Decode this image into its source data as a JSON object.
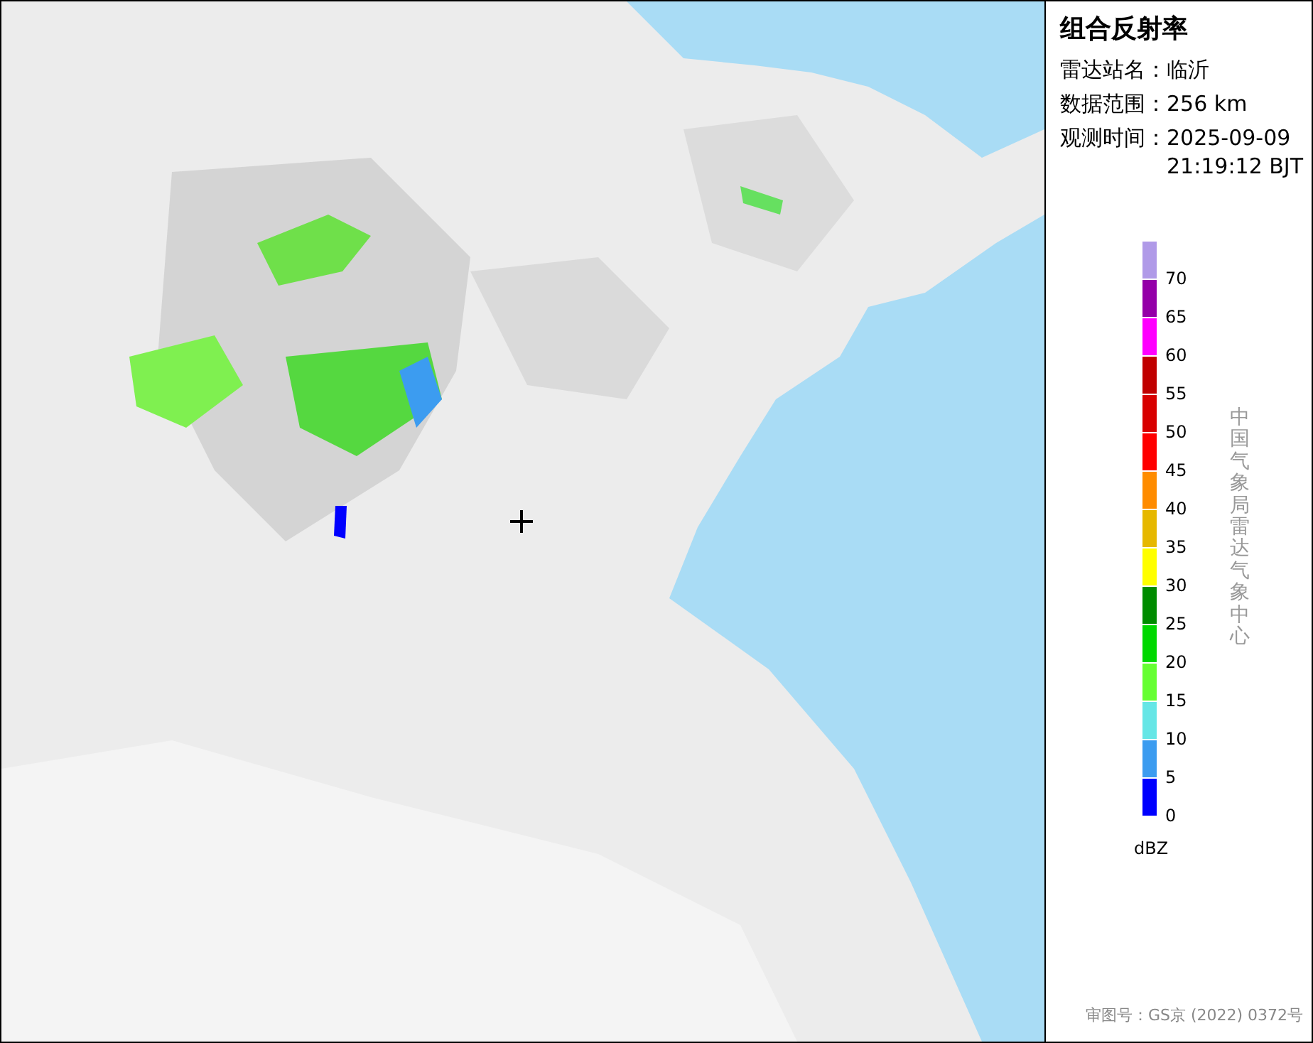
{
  "panel": {
    "title": "组合反射率",
    "info": [
      {
        "label": "雷达站名：",
        "lines": [
          "临沂"
        ]
      },
      {
        "label": "数据范围：",
        "lines": [
          "256 km"
        ]
      },
      {
        "label": "观测时间：",
        "lines": [
          "2025-09-09",
          "21:19:12 BJT"
        ]
      }
    ],
    "legend": [
      {
        "label": "70",
        "color": "#b09ae8"
      },
      {
        "label": "65",
        "color": "#9400a8"
      },
      {
        "label": "60",
        "color": "#ff00ff"
      },
      {
        "label": "55",
        "color": "#c00000"
      },
      {
        "label": "50",
        "color": "#d80000"
      },
      {
        "label": "45",
        "color": "#ff0000"
      },
      {
        "label": "40",
        "color": "#ff8c00"
      },
      {
        "label": "35",
        "color": "#e6b800"
      },
      {
        "label": "30",
        "color": "#ffff00"
      },
      {
        "label": "25",
        "color": "#008c00"
      },
      {
        "label": "20",
        "color": "#00d800"
      },
      {
        "label": "15",
        "color": "#66ff33"
      },
      {
        "label": "10",
        "color": "#66e6e6"
      },
      {
        "label": "5",
        "color": "#3c9cf0"
      },
      {
        "label": "0",
        "color": "#0000ff"
      }
    ],
    "unit": "dBZ",
    "credit": "中国气象局雷达气象中心",
    "review_number": "审图号：GS京 (2022) 0372号"
  }
}
